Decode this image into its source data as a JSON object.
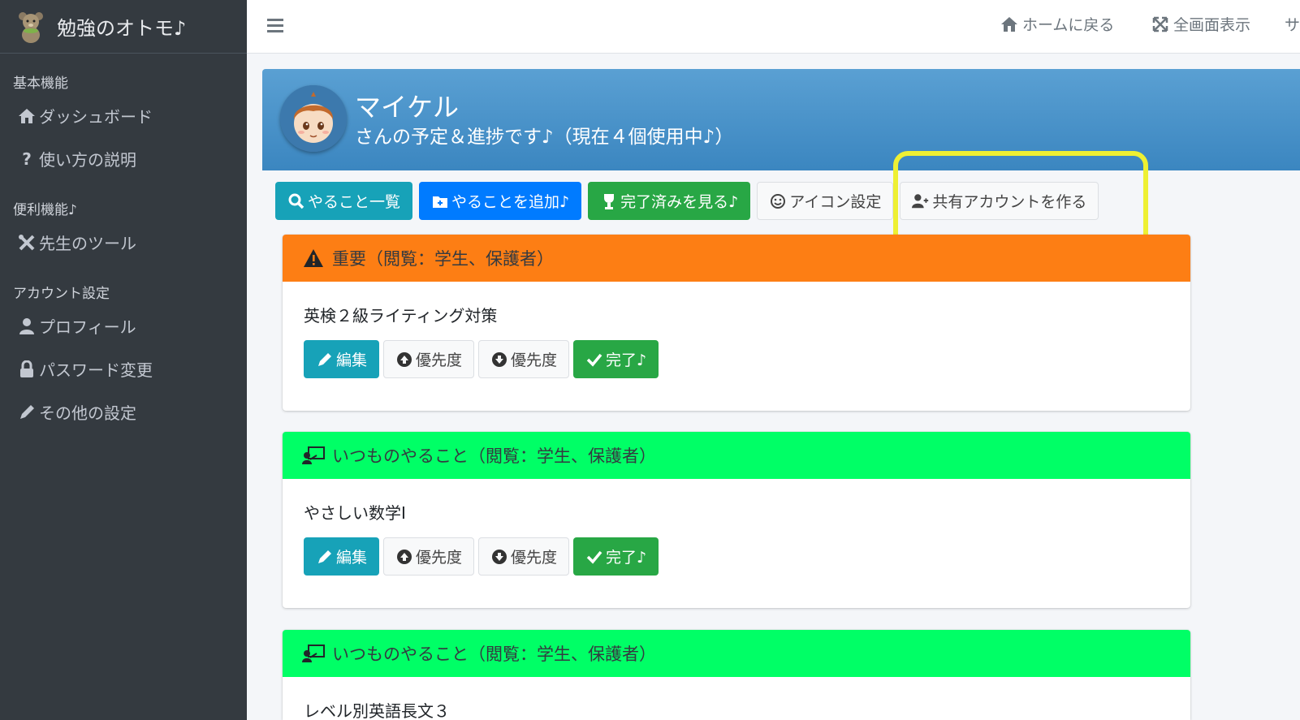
{
  "sidebar": {
    "brand": "勉強のオトモ♪",
    "sections": [
      {
        "header": "基本機能",
        "items": [
          {
            "label": "ダッシュボード",
            "icon": "house-icon"
          },
          {
            "label": "使い方の説明",
            "icon": "question-icon"
          }
        ]
      },
      {
        "header": "便利機能♪",
        "items": [
          {
            "label": "先生のツール",
            "icon": "tools-icon"
          }
        ]
      },
      {
        "header": "アカウント設定",
        "items": [
          {
            "label": "プロフィール",
            "icon": "user-icon"
          },
          {
            "label": "パスワード変更",
            "icon": "lock-icon"
          },
          {
            "label": "その他の設定",
            "icon": "pencil-icon"
          }
        ]
      }
    ]
  },
  "topbar": {
    "home_label": "ホームに戻る",
    "fullscreen_label": "全画面表示",
    "cut_label": "サ"
  },
  "profile": {
    "name": "マイケル",
    "subtitle": "さんの予定＆進捗です♪（現在４個使用中♪）"
  },
  "actions": {
    "list": "やること一覧",
    "add": "やることを追加♪",
    "done": "完了済みを見る♪",
    "icon_settings": "アイコン設定",
    "shared_account": "共有アカウントを作る"
  },
  "task_buttons": {
    "edit": "編集",
    "priority_up": "優先度",
    "priority_down": "優先度",
    "complete": "完了♪"
  },
  "cards": [
    {
      "header": "重要（閲覧：学生、保護者）",
      "title": "英検２級ライティング対策",
      "color": "#fd7e14"
    },
    {
      "header": "いつものやること（閲覧：学生、保護者）",
      "title": "やさしい数学Ⅰ",
      "color": "#00ff66"
    },
    {
      "header": "いつものやること（閲覧：学生、保護者）",
      "title": "レベル別英語長文３",
      "color": "#00ff66"
    }
  ],
  "colors": {
    "sidebar": "#343a40",
    "header_blue": "#3b86c0",
    "info": "#17a2b8",
    "primary": "#007bff",
    "success": "#28a745",
    "highlight": "#eef033"
  }
}
